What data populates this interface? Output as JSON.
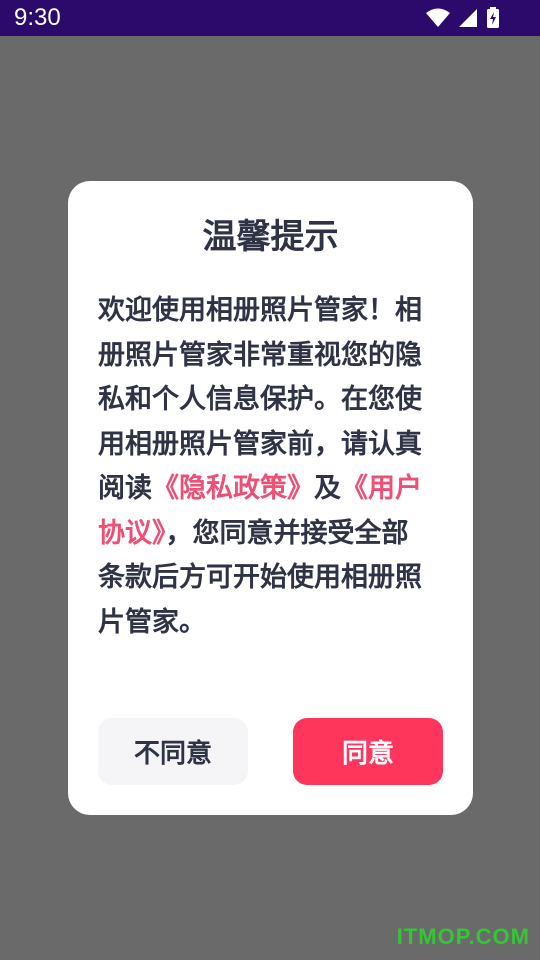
{
  "status_bar": {
    "time": "9:30"
  },
  "dialog": {
    "title": "温馨提示",
    "body": {
      "part1": "欢迎使用相册照片管家！相册照片管家非常重视您的隐私和个人信息保护。在您使用相册照片管家前，请认真阅读",
      "privacy_link": "《隐私政策》",
      "part2": "及",
      "agreement_link": "《用户协议》",
      "part3": "，您同意并接受全部条款后方可开始使用相册照片管家。"
    },
    "disagree_label": "不同意",
    "agree_label": "同意"
  },
  "watermark": "ITMOP.COM",
  "colors": {
    "status_bar": "#2b0a6b",
    "scrim": "#6a6a6a",
    "link": "#ee4f74",
    "agree_button": "#fe365c",
    "disagree_button": "#f5f5f7",
    "text": "#2f3345"
  }
}
